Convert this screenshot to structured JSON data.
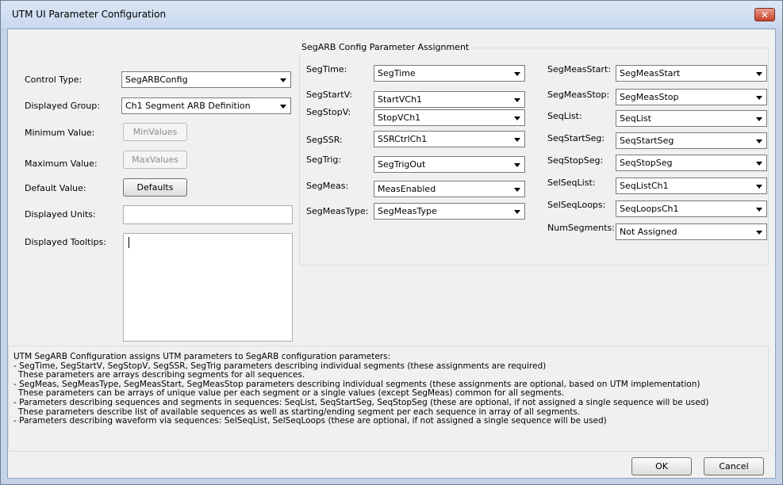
{
  "window": {
    "title": "UTM UI Parameter Configuration",
    "close_glyph": "✕"
  },
  "left": {
    "control_type": {
      "label": "Control Type:",
      "value": "SegARBConfig"
    },
    "displayed_group": {
      "label": "Displayed Group:",
      "value": "Ch1 Segment ARB Definition"
    },
    "minimum_value": {
      "label": "Minimum Value:",
      "button": "MinValues"
    },
    "maximum_value": {
      "label": "Maximum Value:",
      "button": "MaxValues"
    },
    "default_value": {
      "label": "Default Value:",
      "button": "Defaults"
    },
    "displayed_units": {
      "label": "Displayed Units:",
      "value": ""
    },
    "displayed_tooltips": {
      "label": "Displayed Tooltips:",
      "value": ""
    }
  },
  "group": {
    "title": "SegARB Config Parameter Assignment",
    "left_col": [
      {
        "label": "SegTime:",
        "value": "SegTime"
      },
      {
        "label": "SegStartV:",
        "value": "StartVCh1"
      },
      {
        "label": "SegStopV:",
        "value": "StopVCh1"
      },
      {
        "label": "SegSSR:",
        "value": "SSRCtrlCh1"
      },
      {
        "label": "SegTrig:",
        "value": "SegTrigOut"
      },
      {
        "label": "SegMeas:",
        "value": "MeasEnabled"
      },
      {
        "label": "SegMeasType:",
        "value": "SegMeasType"
      }
    ],
    "right_col": [
      {
        "label": "SegMeasStart:",
        "value": "SegMeasStart"
      },
      {
        "label": "SegMeasStop:",
        "value": "SegMeasStop"
      },
      {
        "label": "SeqList:",
        "value": "SeqList"
      },
      {
        "label": "SeqStartSeg:",
        "value": "SeqStartSeg"
      },
      {
        "label": "SeqStopSeg:",
        "value": "SeqStopSeg"
      },
      {
        "label": "SelSeqList:",
        "value": "SeqListCh1"
      },
      {
        "label": "SelSeqLoops:",
        "value": "SeqLoopsCh1"
      },
      {
        "label": "NumSegments:",
        "value": "Not Assigned"
      }
    ]
  },
  "info_lines": [
    "UTM SegARB Configuration assigns UTM parameters to SegARB configuration parameters:",
    "- SegTime, SegStartV, SegStopV, SegSSR, SegTrig parameters describing individual segments (these assignments are required)",
    "  These parameters are arrays describing segments for all sequences.",
    "- SegMeas, SegMeasType, SegMeasStart, SegMeasStop parameters describing individual segments (these assignments are optional, based on UTM implementation)",
    "  These parameters can be arrays of unique value per each segment or a single values (except SegMeas) common for all segments.",
    "- Parameters describing sequences and segments in sequences: SeqList, SeqStartSeg, SeqStopSeg (these are optional, if not assigned a single sequence will be used)",
    "  These parameters describe list of available sequences as well as starting/ending segment per each sequence in array of all segments.",
    "- Parameters describing waveform via sequences: SelSeqList, SelSeqLoops (these are optional, if not assigned a single sequence will be used)"
  ],
  "buttons": {
    "ok": "OK",
    "cancel": "Cancel"
  }
}
